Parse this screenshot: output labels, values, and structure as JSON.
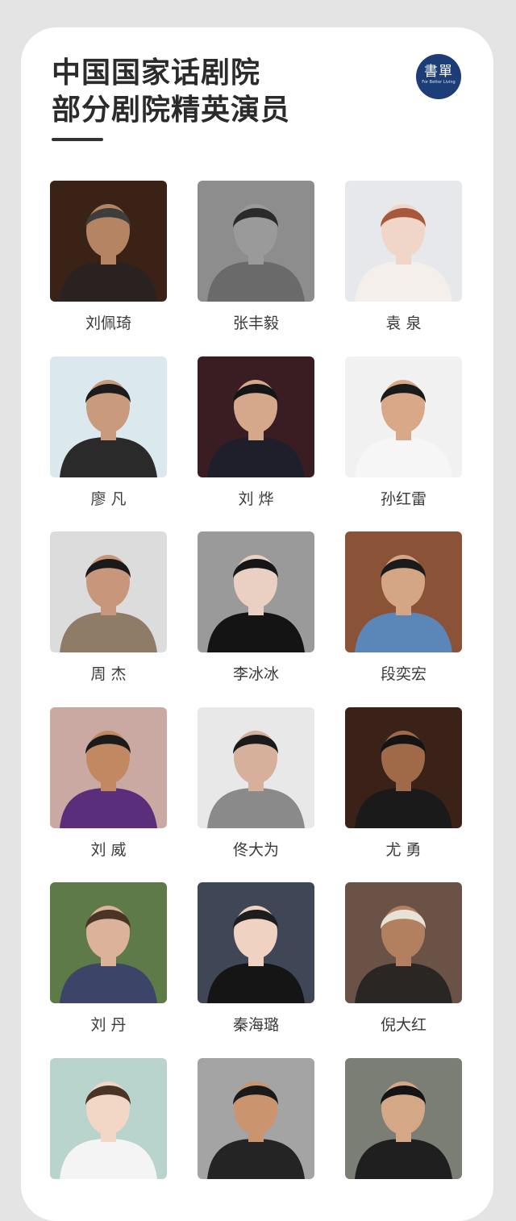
{
  "header": {
    "title_line1": "中国国家话剧院",
    "title_line2": "部分剧院精英演员",
    "logo_text": "書單",
    "logo_subtext": "For Better Living"
  },
  "actors": [
    {
      "name": "刘佩琦",
      "bg": "#3a2216",
      "coat": "#2a2220",
      "skin": "#b58563",
      "hair": "#3d3d3d"
    },
    {
      "name": "张丰毅",
      "bg": "#8d8d8d",
      "coat": "#6a6a6a",
      "skin": "#9a9a9a",
      "hair": "#2a2a2a"
    },
    {
      "name": "袁 泉",
      "bg": "#e6e8ec",
      "coat": "#f4efea",
      "skin": "#f0d6c8",
      "hair": "#a8583a"
    },
    {
      "name": "廖 凡",
      "bg": "#dbe9ef",
      "coat": "#2a2a2a",
      "skin": "#c99a7c",
      "hair": "#1c1c1c"
    },
    {
      "name": "刘 烨",
      "bg": "#3a1d22",
      "coat": "#1e1f2a",
      "skin": "#d6a88b",
      "hair": "#151515"
    },
    {
      "name": "孙红雷",
      "bg": "#f1f1f1",
      "coat": "#f6f6f6",
      "skin": "#d8a889",
      "hair": "#1a1a1a"
    },
    {
      "name": "周 杰",
      "bg": "#dcdcdc",
      "coat": "#8f7c66",
      "skin": "#c8967a",
      "hair": "#1a1a1a"
    },
    {
      "name": "李冰冰",
      "bg": "#9a9a9a",
      "coat": "#141414",
      "skin": "#ead0c2",
      "hair": "#161616"
    },
    {
      "name": "段奕宏",
      "bg": "#8a5236",
      "coat": "#5a86b8",
      "skin": "#d4a686",
      "hair": "#1b1b1b"
    },
    {
      "name": "刘 威",
      "bg": "#c9a9a2",
      "coat": "#5a2e7a",
      "skin": "#c28862",
      "hair": "#1b1b1b"
    },
    {
      "name": "佟大为",
      "bg": "#e8e8e8",
      "coat": "#8a8a8a",
      "skin": "#d6b09a",
      "hair": "#1a1a1a"
    },
    {
      "name": "尤 勇",
      "bg": "#3a2218",
      "coat": "#1a1a1a",
      "skin": "#a06a48",
      "hair": "#141414"
    },
    {
      "name": "刘 丹",
      "bg": "#5d7a48",
      "coat": "#3c4568",
      "skin": "#dcb39a",
      "hair": "#4a3426"
    },
    {
      "name": "秦海璐",
      "bg": "#3f4656",
      "coat": "#151515",
      "skin": "#efd2c2",
      "hair": "#1d1d1d"
    },
    {
      "name": "倪大红",
      "bg": "#6a5346",
      "coat": "#2a2624",
      "skin": "#b2805e",
      "hair": "#e8e2d6"
    },
    {
      "name": "",
      "bg": "#b8d4cc",
      "coat": "#f4f4f4",
      "skin": "#f2d6c6",
      "hair": "#4a3426"
    },
    {
      "name": "",
      "bg": "#a4a4a4",
      "coat": "#242424",
      "skin": "#c9946e",
      "hair": "#1a1a1a"
    },
    {
      "name": "",
      "bg": "#7b7e74",
      "coat": "#1f1f1f",
      "skin": "#d4a886",
      "hair": "#141414"
    }
  ]
}
